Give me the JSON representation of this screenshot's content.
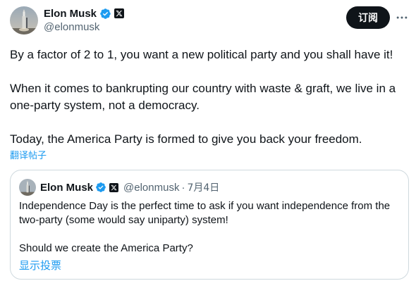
{
  "author": {
    "name": "Elon Musk",
    "handle": "@elonmusk",
    "avatar_icon": "rocket-launch-avatar",
    "verified_color": "#1d9bf0"
  },
  "actions": {
    "subscribe_label": "订阅",
    "more_icon": "more-horizontal-icon"
  },
  "tweet": {
    "paragraphs": [
      "By a factor of 2 to 1, you want a new political party and you shall have it!",
      "When it comes to bankrupting our country with waste & graft, we live in a one-party system, not a democracy.",
      "Today, the America Party is formed to give you back your freedom."
    ],
    "translate_label": "翻译帖子"
  },
  "quoted": {
    "name": "Elon Musk",
    "handle": "@elonmusk",
    "separator": "·",
    "date": "7月4日",
    "paragraphs": [
      "Independence Day is the perfect time to ask if you want independence from the two-party (some would say uniparty) system!",
      "Should we create the America Party?"
    ],
    "poll_label": "显示投票"
  },
  "colors": {
    "text": "#0f1419",
    "secondary": "#536471",
    "link": "#1d9bf0",
    "border": "#cfd9de"
  }
}
